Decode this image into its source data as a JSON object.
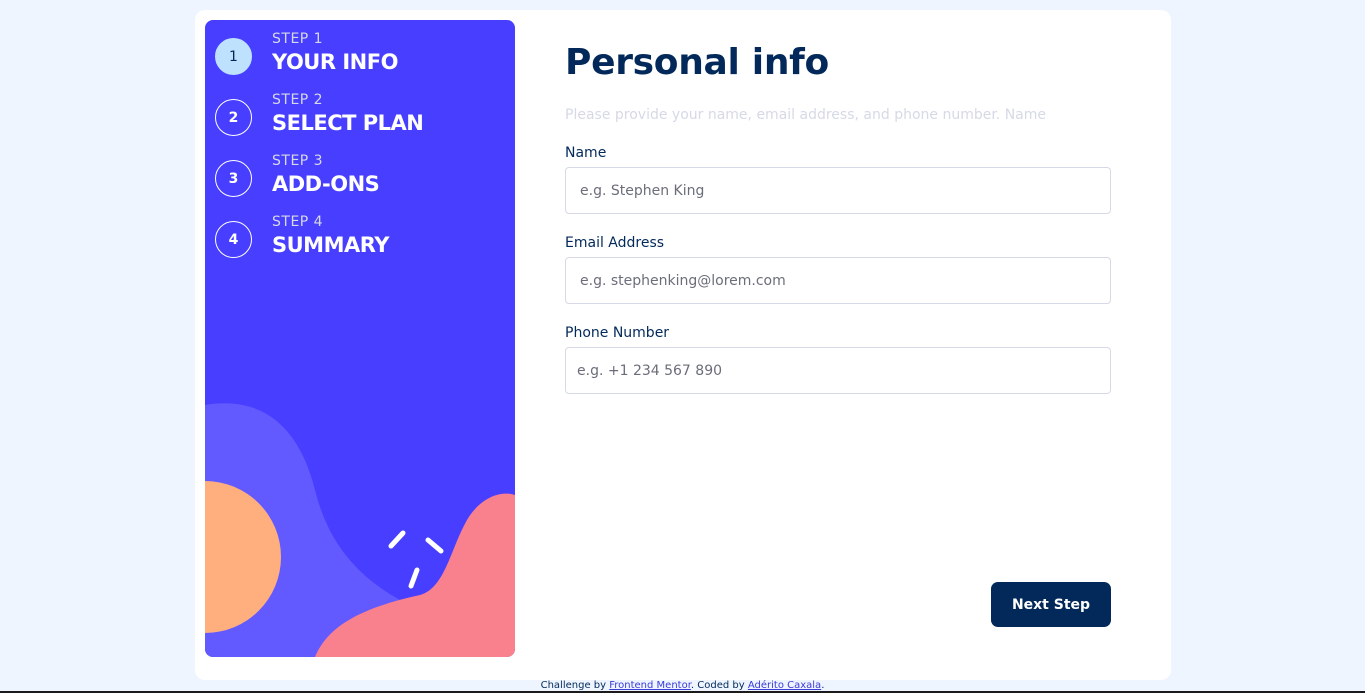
{
  "sidebar": {
    "steps": [
      {
        "number": "1",
        "label": "STEP 1",
        "title": "YOUR INFO",
        "active": true
      },
      {
        "number": "2",
        "label": "STEP 2",
        "title": "SELECT PLAN",
        "active": false
      },
      {
        "number": "3",
        "label": "STEP 3",
        "title": "ADD-ONS",
        "active": false
      },
      {
        "number": "4",
        "label": "STEP 4",
        "title": "SUMMARY",
        "active": false
      }
    ],
    "colors": {
      "background": "#483eff",
      "wave": "#6259ff",
      "orange": "#ffaf7e",
      "pink": "#f9818e",
      "active_circle": "#bee2fd"
    }
  },
  "main": {
    "title": "Personal info",
    "subtitle": "Please provide your name, email address, and phone number. Name",
    "fields": {
      "name": {
        "label": "Name",
        "placeholder": "e.g. Stephen King"
      },
      "email": {
        "label": "Email Address",
        "placeholder": "e.g. stephenking@lorem.com"
      },
      "phone": {
        "label": "Phone Number",
        "placeholder": "e.g. +1 234 567 890"
      }
    },
    "next_label": "Next Step"
  },
  "footer": {
    "prefix": "Challenge by ",
    "link1": "Frontend Mentor",
    "middle": ". Coded by ",
    "link2": "Adérito Caxala",
    "suffix": "."
  },
  "colors": {
    "page_bg": "#eff5ff",
    "marine_blue": "#02295a",
    "light_gray": "#d6d9e6"
  }
}
